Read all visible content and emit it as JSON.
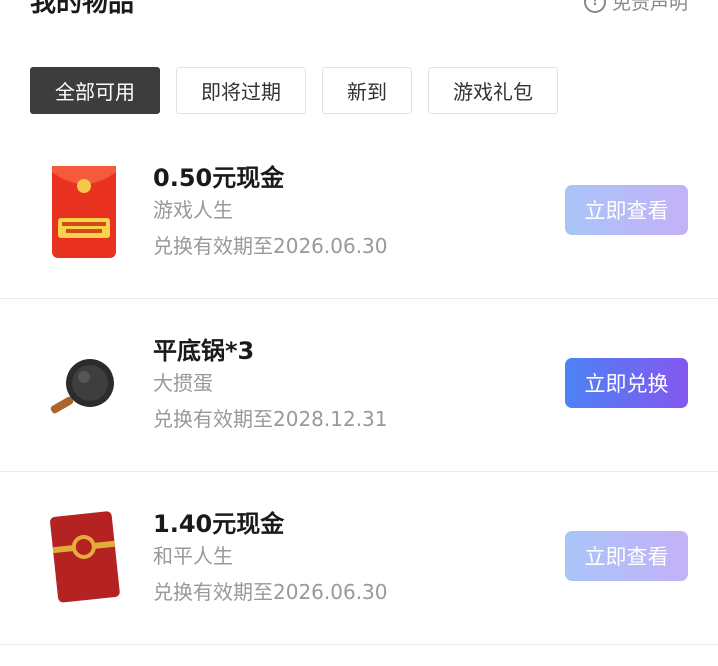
{
  "header": {
    "title": "我的物品",
    "disclaimer": "免责声明",
    "disclaimer_icon": "info-icon"
  },
  "filters": [
    {
      "label": "全部可用",
      "active": true
    },
    {
      "label": "即将过期",
      "active": false
    },
    {
      "label": "新到",
      "active": false
    },
    {
      "label": "游戏礼包",
      "active": false
    }
  ],
  "items": [
    {
      "title": "0.50元现金",
      "source": "游戏人生",
      "expiry": "兑换有效期至2026.06.30",
      "action": "立即查看",
      "image": "red-envelope-icon"
    },
    {
      "title": "平底锅*3",
      "source": "大掼蛋",
      "expiry": "兑换有效期至2028.12.31",
      "action": "立即兑换",
      "image": "frying-pan-icon"
    },
    {
      "title": "1.40元现金",
      "source": "和平人生",
      "expiry": "兑换有效期至2026.06.30",
      "action": "立即查看",
      "image": "red-envelope-icon"
    }
  ],
  "colors": {
    "action_primary_start": "#4d83f4",
    "action_primary_end": "#8457f0",
    "filter_active_bg": "#3d3d3d"
  }
}
